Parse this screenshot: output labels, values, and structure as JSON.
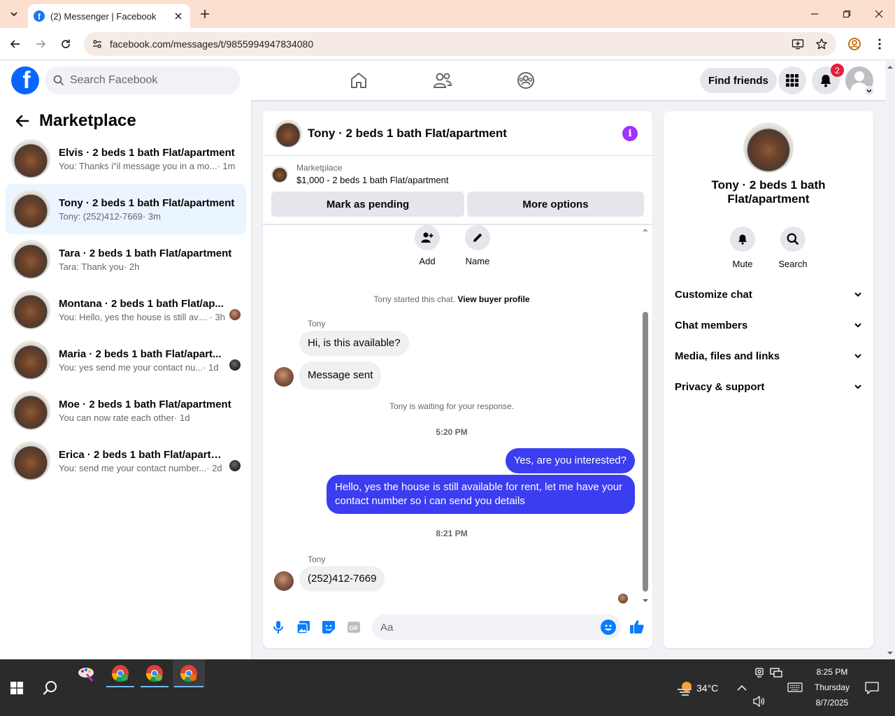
{
  "browser": {
    "tab_title": "(2) Messenger | Facebook",
    "url": "facebook.com/messages/t/9855994947834080"
  },
  "header": {
    "search_placeholder": "Search Facebook",
    "find_friends": "Find friends",
    "notifications_count": "2"
  },
  "sidebar": {
    "title": "Marketplace",
    "conversations": [
      {
        "name": "Elvis · 2 beds 1 bath Flat/apartment",
        "preview": "You: Thanks i\"il message you in a mo...",
        "time": " · 1m",
        "active": false
      },
      {
        "name": "Tony · 2 beds 1 bath Flat/apartment",
        "preview": "Tony: (252)412-7669",
        "time": " · 3m",
        "active": true
      },
      {
        "name": "Tara · 2 beds 1 bath Flat/apartment",
        "preview": "Tara: Thank you",
        "time": " · 2h",
        "active": false
      },
      {
        "name": "Montana · 2 beds 1 bath Flat/ap...",
        "preview": "You: Hello, yes the house is still ava...",
        "time": " · 3h",
        "active": false
      },
      {
        "name": "Maria · 2 beds 1 bath Flat/apart...",
        "preview": "You: yes send me your contact nu...",
        "time": " · 1d",
        "active": false
      },
      {
        "name": "Moe · 2 beds 1 bath Flat/apartment",
        "preview": "You can now rate each other",
        "time": " · 1d",
        "active": false
      },
      {
        "name": "Erica · 2 beds 1 bath Flat/apartm...",
        "preview": "You: send me your contact number...",
        "time": " · 2d",
        "active": false
      }
    ]
  },
  "chat": {
    "title": "Tony · 2 beds 1 bath Flat/apartment",
    "listing_category": "Marketplace",
    "listing_price": "$1,000 - 2 beds 1 bath Flat/apartment",
    "mark_pending": "Mark as pending",
    "more_options": "More options",
    "action_add": "Add",
    "action_name": "Name",
    "started_text": "Tony started this chat. ",
    "view_profile": "View buyer profile",
    "sender_name": "Tony",
    "msg1": "Hi, is this available?",
    "msg2": "Message sent",
    "waiting": "Tony is waiting for your response.",
    "time1": "5:20 PM",
    "out1": "Yes, are you interested?",
    "out2": "Hello, yes the house is still available for rent, let me have your contact number so i can send you details",
    "time2": "8:21 PM",
    "msg3": "(252)412-7669",
    "composer_placeholder": "Aa"
  },
  "rpanel": {
    "title": "Tony · 2 beds 1 bath Flat/apartment",
    "mute": "Mute",
    "search": "Search",
    "rows": [
      "Customize chat",
      "Chat members",
      "Media, files and links",
      "Privacy & support"
    ]
  },
  "taskbar": {
    "temperature": "34°C",
    "time": "8:25 PM",
    "day": "Thursday",
    "date": "8/7/2025"
  }
}
